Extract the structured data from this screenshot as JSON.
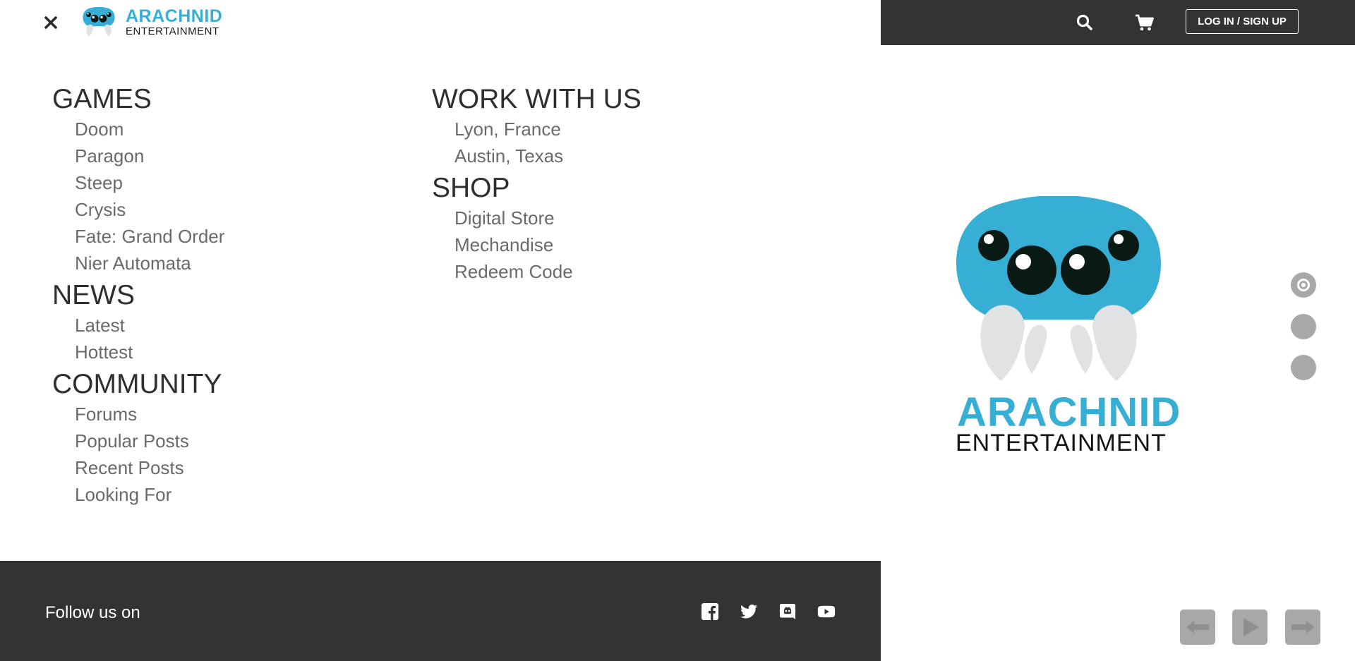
{
  "brand": {
    "name_top": "ARACHNID",
    "name_bottom": "ENTERTAINMENT"
  },
  "header": {
    "login_label": "LOG IN / SIGN UP",
    "search_icon": "search-icon",
    "cart_icon": "cart-icon"
  },
  "menu": {
    "columns": [
      {
        "sections": [
          {
            "title": "GAMES",
            "items": [
              "Doom",
              "Paragon",
              "Steep",
              "Crysis",
              "Fate: Grand Order",
              "Nier Automata"
            ]
          },
          {
            "title": "NEWS",
            "items": [
              "Latest",
              "Hottest"
            ]
          },
          {
            "title": "COMMUNITY",
            "items": [
              "Forums",
              "Popular Posts",
              "Recent Posts",
              "Looking For"
            ]
          }
        ]
      },
      {
        "sections": [
          {
            "title": "WORK WITH US",
            "items": [
              "Lyon, France",
              "Austin, Texas"
            ]
          },
          {
            "title": "SHOP",
            "items": [
              "Digital Store",
              "Mechandise",
              "Redeem Code"
            ]
          }
        ]
      }
    ]
  },
  "footer": {
    "follow_text": "Follow us on",
    "socials": [
      "facebook-icon",
      "twitter-icon",
      "discord-icon",
      "youtube-icon"
    ]
  },
  "hero": {
    "title": "ARACHNID",
    "subtitle": "ENTERTAINMENT",
    "slide_count": 3,
    "active_slide": 1,
    "controls": [
      "arrow-left-icon",
      "play-icon",
      "arrow-right-icon"
    ]
  },
  "colors": {
    "brand_blue": "#37aed3",
    "dark_bar": "#333333",
    "menu_heading": "#2f2f2f",
    "menu_item": "#6a6a6a",
    "control_gray": "#a8a8a8"
  }
}
